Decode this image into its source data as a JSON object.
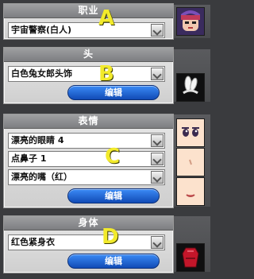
{
  "sections": [
    {
      "title": "职业",
      "fields": [
        "宇宙警察(白人)"
      ],
      "letter": "A",
      "has_edit": false,
      "icon": "character-face-icon"
    },
    {
      "title": "头",
      "fields": [
        "白色兔女郎头饰"
      ],
      "letter": "B",
      "has_edit": true,
      "icon": "rabbit-ears-icon"
    },
    {
      "title": "表情",
      "fields": [
        "漂亮的眼睛 4",
        "点鼻子 1",
        "漂亮的嘴（红）"
      ],
      "letter": "C",
      "has_edit": true,
      "icons": [
        "eyes-face-icon",
        "nose-face-icon",
        "mouth-face-icon"
      ]
    },
    {
      "title": "身体",
      "fields": [
        "红色紧身衣"
      ],
      "letter": "D",
      "has_edit": true,
      "icon": "body-suit-icon"
    }
  ],
  "edit_label": "编辑",
  "colors": {
    "letter": "#f2ea2b",
    "button": "#1f62d6"
  }
}
